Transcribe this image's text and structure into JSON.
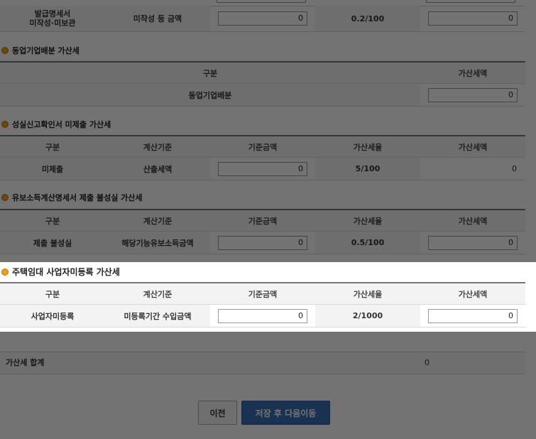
{
  "top_section": {
    "row_label_line1": "발급명세서",
    "row_label_line2": "미작성·미보관",
    "basis": "미작성 등 금액",
    "base_amount": "0",
    "rate": "0.2/100",
    "tax": "0"
  },
  "coop_section": {
    "title": "동업기업배분 가산세",
    "headers": [
      "구분",
      "가산세액"
    ],
    "row_label": "동업기업배분",
    "tax": "0"
  },
  "confirm_section": {
    "title": "성실신고확인서 미제출 가산세",
    "headers": [
      "구분",
      "계산기준",
      "기준금액",
      "가산세율",
      "가산세액"
    ],
    "row_label": "미제출",
    "basis": "산출세액",
    "base_amount": "0",
    "rate": "5/100",
    "tax": "0"
  },
  "dividend_section": {
    "title": "유보소득계산명세서 제출 불성실 가산세",
    "headers": [
      "구분",
      "계산기준",
      "기준금액",
      "가산세율",
      "가산세액"
    ],
    "row_label": "제출 불성실",
    "basis": "해당기능유보소득금액",
    "base_amount": "0",
    "rate": "0.5/100",
    "tax": "0"
  },
  "rental_section": {
    "title": "주택임대 사업자미등록 가산세",
    "headers": [
      "구분",
      "계산기준",
      "기준금액",
      "가산세율",
      "가산세액"
    ],
    "row_label": "사업자미등록",
    "basis": "미등록기간 수입금액",
    "base_amount": "0",
    "rate": "2/1000",
    "tax": "0"
  },
  "total": {
    "label": "가산세 합계",
    "value": "0"
  },
  "buttons": {
    "prev": "이전",
    "next": "저장 후 다음이동"
  },
  "colors": {
    "bullet": "#e8a21a",
    "primary_button": "#3a6fb5",
    "overlay": "rgba(0,0,0,0.55)"
  }
}
